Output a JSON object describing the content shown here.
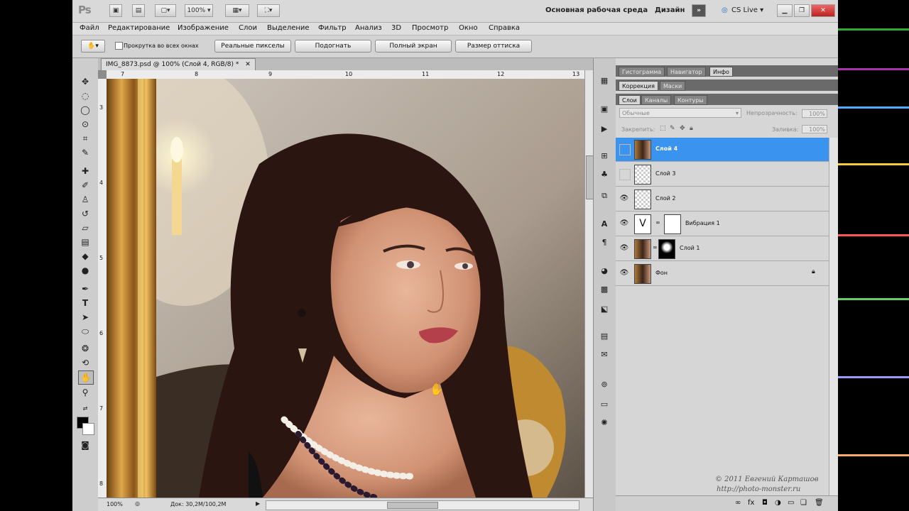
{
  "app": {
    "logo": "Ps",
    "zoom_select": "100%",
    "workspace": "Основная рабочая среда",
    "design": "Дизайн",
    "more": "»",
    "cslive": "CS Live"
  },
  "menu": [
    "Файл",
    "Редактирование",
    "Изображение",
    "Слои",
    "Выделение",
    "Фильтр",
    "Анализ",
    "3D",
    "Просмотр",
    "Окно",
    "Справка"
  ],
  "options": {
    "scroll_all_label": "Прокрутка во всех окнах",
    "btn_actual_pixels": "Реальные пикселы",
    "btn_fit": "Подогнать",
    "btn_fullscreen": "Полный экран",
    "btn_print_size": "Размер оттиска"
  },
  "document": {
    "tab_title": "IMG_8873.psd @ 100% (Слой 4, RGB/8) *",
    "status_zoom": "100%",
    "status_doc": "Док: 30,2M/100,2M",
    "ruler_h": [
      "7",
      "8",
      "9",
      "10",
      "11",
      "12",
      "13"
    ],
    "ruler_v": [
      "3",
      "4",
      "5",
      "6",
      "7",
      "8"
    ]
  },
  "panels": {
    "top_tabs": [
      "Гистограмма",
      "Навигатор",
      "Инфо"
    ],
    "mid_tabs": [
      "Коррекция",
      "Маски"
    ],
    "layer_tabs": [
      "Слои",
      "Каналы",
      "Контуры"
    ],
    "blend_mode": "Обычные",
    "opacity_label": "Непрозрачность:",
    "opacity_value": "100%",
    "lock_label": "Закрепить:",
    "fill_label": "Заливка:",
    "fill_value": "100%"
  },
  "layers": [
    {
      "name": "Слой 4",
      "visible": false,
      "selected": true
    },
    {
      "name": "Слой 3",
      "visible": false,
      "selected": false
    },
    {
      "name": "Слой 2",
      "visible": true,
      "selected": false
    },
    {
      "name": "Вибрация 1",
      "visible": true,
      "selected": false
    },
    {
      "name": "Слой 1",
      "visible": true,
      "selected": false
    },
    {
      "name": "Фон",
      "visible": true,
      "selected": false
    }
  ],
  "watermark": {
    "line1": "© 2011 Евгений Карташов",
    "line2": "http://photo-monster.ru"
  },
  "colors": {
    "selection": "#3a93ef",
    "ui_bg": "#d6d6d6"
  }
}
